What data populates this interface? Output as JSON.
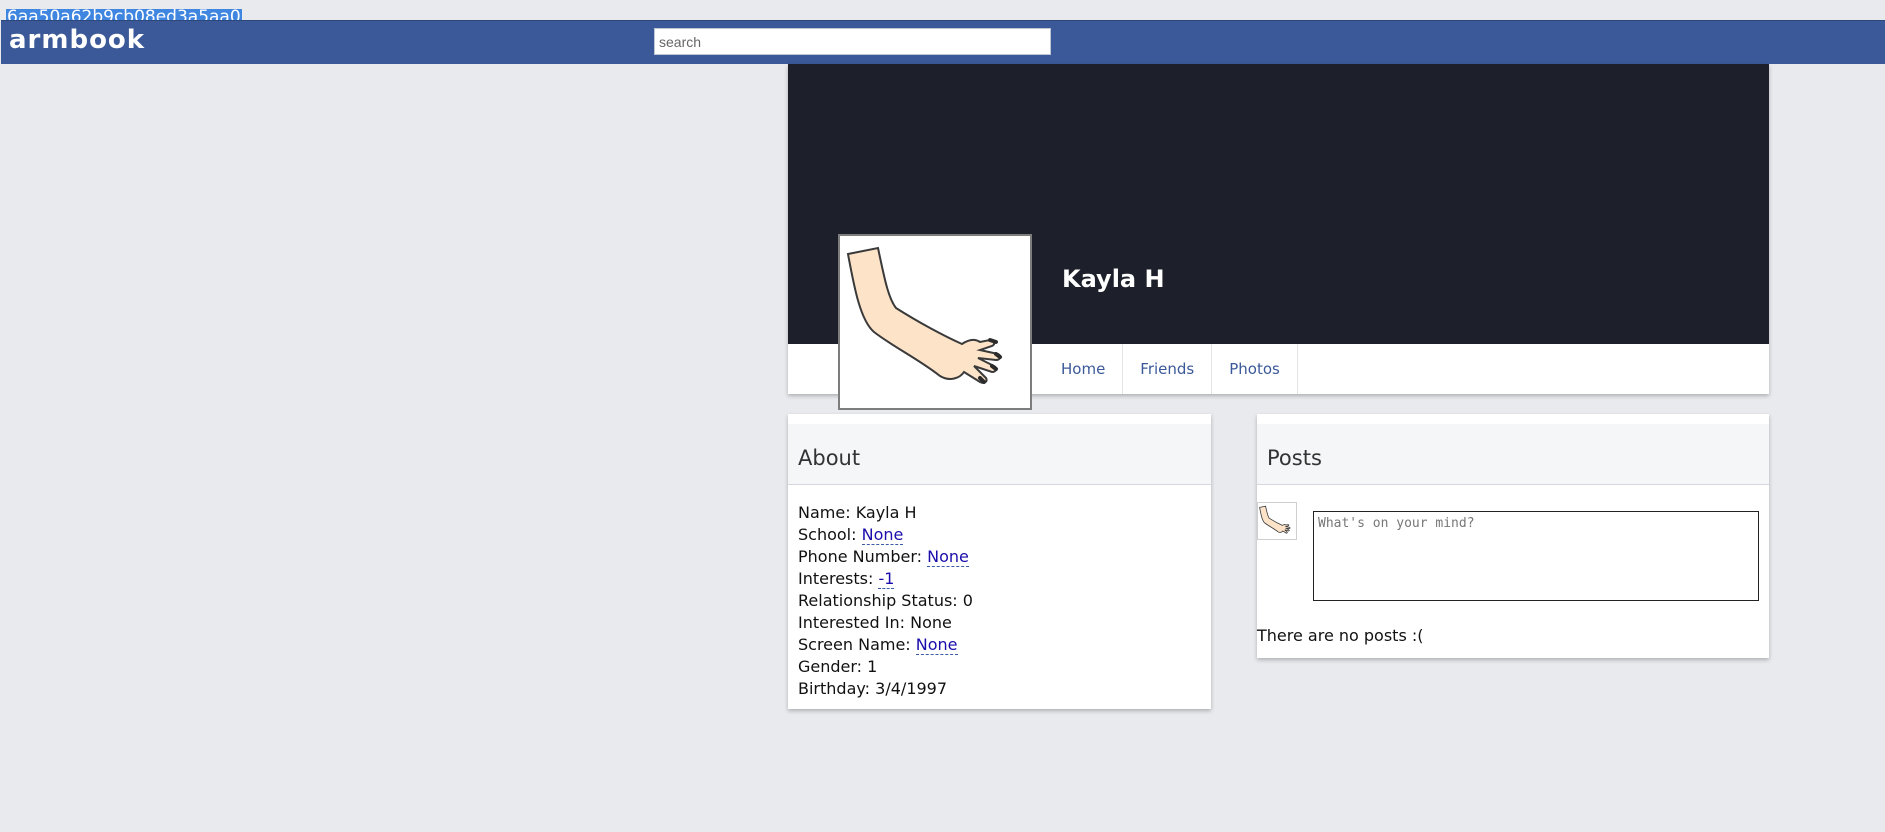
{
  "session_id": "6aa50a62b9cb08ed3a5aa0",
  "topbar": {
    "logo": "armbook",
    "search_placeholder": "search"
  },
  "profile": {
    "name": "Kayla H",
    "nav": [
      "Home",
      "Friends",
      "Photos"
    ]
  },
  "about": {
    "title": "About",
    "rows": [
      {
        "label": "Name:",
        "value": "Kayla H"
      },
      {
        "label": "School:",
        "value": "None"
      },
      {
        "label": "Phone Number:",
        "value": "None"
      },
      {
        "label": "Interests:",
        "value": "-1"
      },
      {
        "label": "Relationship Status:",
        "value": "0"
      },
      {
        "label": "Interested In:",
        "value": "None"
      },
      {
        "label": "Screen Name:",
        "value": "None"
      },
      {
        "label": "Gender:",
        "value": "1"
      },
      {
        "label": "Birthday:",
        "value": "3/4/1997"
      }
    ]
  },
  "posts": {
    "title": "Posts",
    "composer_placeholder": "What's on your mind?",
    "empty_text": "There are no posts :("
  },
  "colors": {
    "topbar": "#3b5998",
    "cover": "#1d202a",
    "link": "#1a0dab",
    "background": "#e9eaee"
  }
}
